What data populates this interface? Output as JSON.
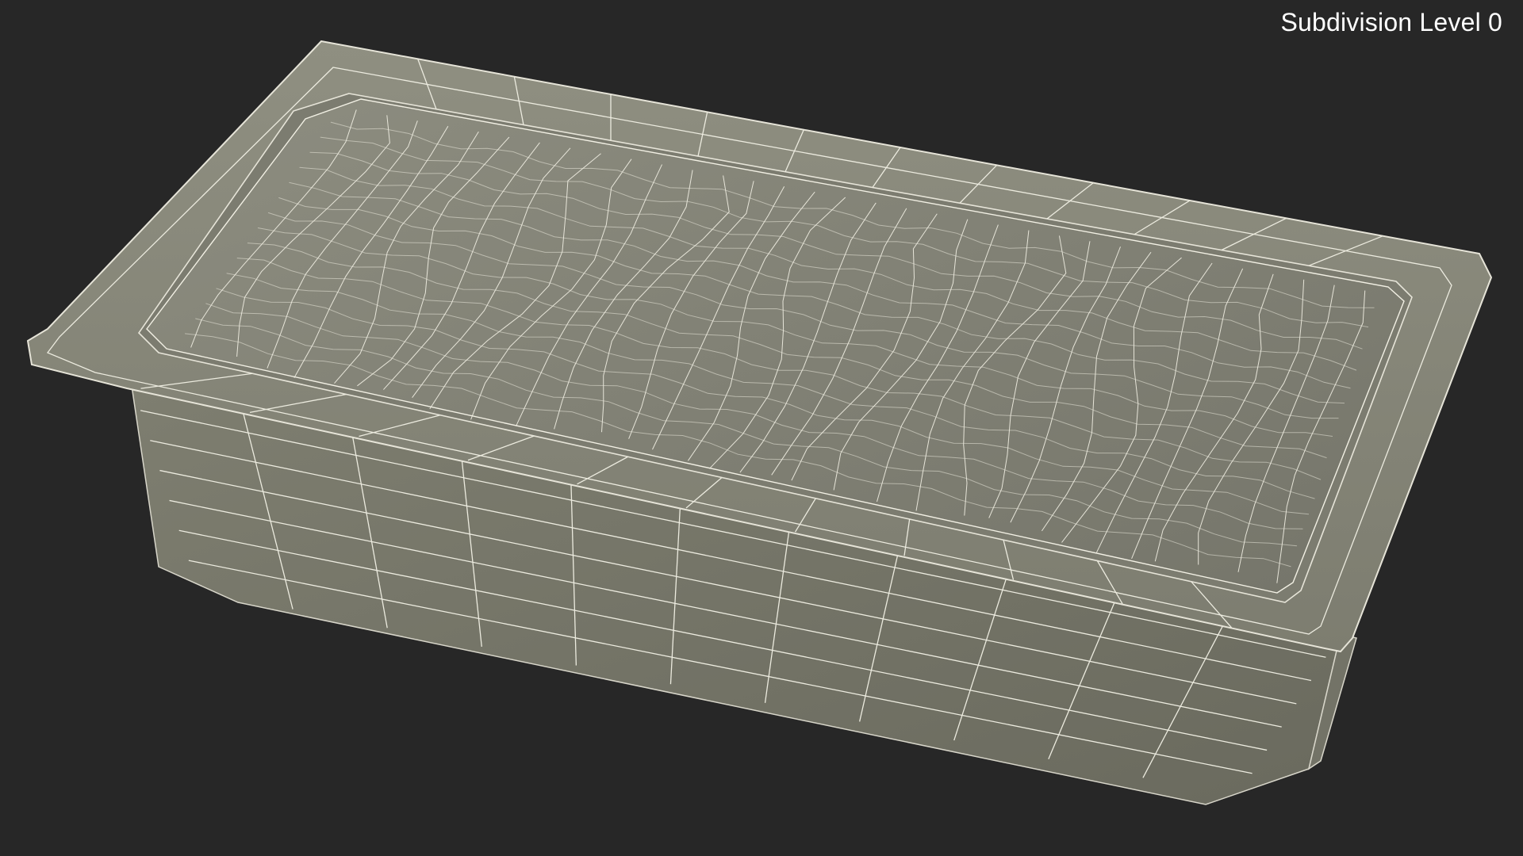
{
  "viewport": {
    "label": "Subdivision Level 0",
    "background_color": "#272727",
    "model_color": "#8a8a7c",
    "wire_color": "#f2f0e4",
    "model_icon": "ice-cream-tray-wireframe"
  }
}
